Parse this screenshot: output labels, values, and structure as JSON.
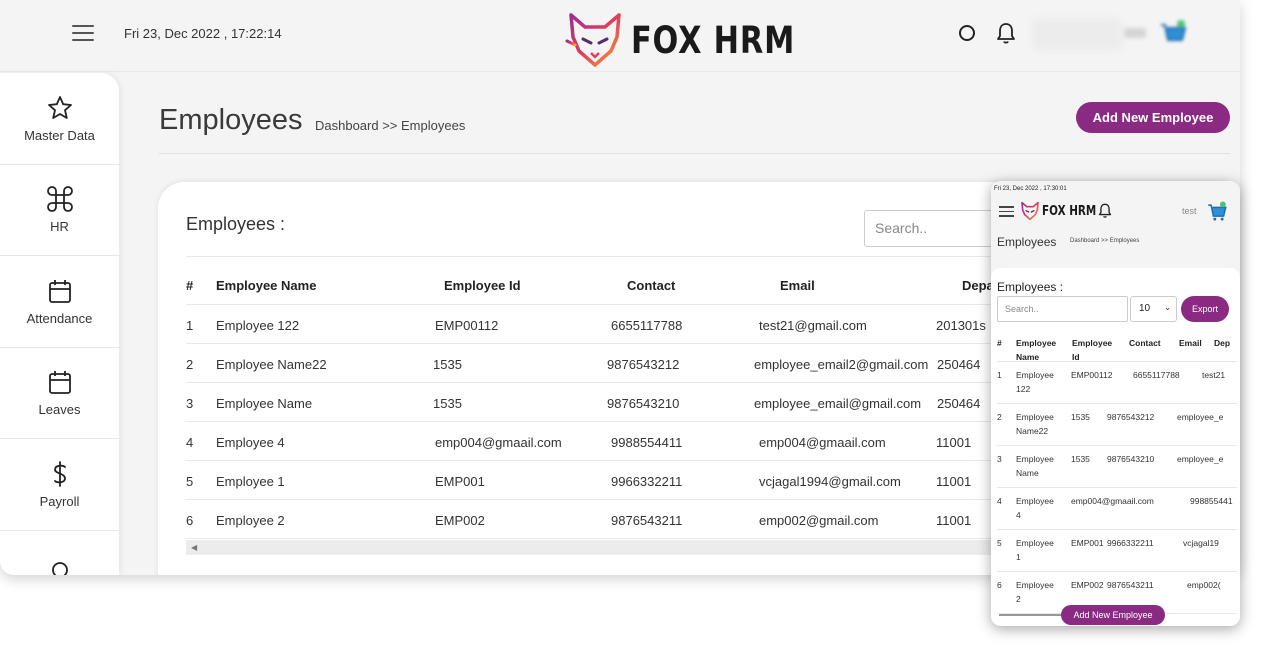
{
  "header": {
    "datetime": "Fri 23, Dec 2022 , 17:22:14",
    "brand": "FOX HRM"
  },
  "sidebar": {
    "items": [
      {
        "label": "Master Data",
        "icon": "star-icon"
      },
      {
        "label": "HR",
        "icon": "command-icon"
      },
      {
        "label": "Attendance",
        "icon": "calendar-icon"
      },
      {
        "label": "Leaves",
        "icon": "calendar-icon"
      },
      {
        "label": "Payroll",
        "icon": "dollar-icon"
      },
      {
        "label": "",
        "icon": "award-icon"
      }
    ]
  },
  "page": {
    "title": "Employees",
    "breadcrumb": "Dashboard >> Employees",
    "add_button": "Add New Employee"
  },
  "card": {
    "title": "Employees :",
    "search_placeholder": "Search.."
  },
  "table": {
    "columns": [
      "#",
      "Employee Name",
      "Employee Id",
      "Contact",
      "Email",
      "Depa"
    ],
    "rows": [
      [
        "1",
        "Employee 122",
        "EMP00112",
        "6655117788",
        "test21@gmail.com",
        "201301s"
      ],
      [
        "2",
        "Employee Name22",
        "1535",
        "9876543212",
        "employee_email2@gmail.com",
        "250464"
      ],
      [
        "3",
        "Employee Name",
        "1535",
        "9876543210",
        "employee_email@gmail.com",
        "250464"
      ],
      [
        "4",
        "Employee 4",
        "emp004@gmaail.com",
        "9988554411",
        "emp004@gmaail.com",
        "11001"
      ],
      [
        "5",
        "Employee 1",
        "EMP001",
        "9966332211",
        "vcjagal1994@gmail.com",
        "11001"
      ],
      [
        "6",
        "Employee 2",
        "EMP002",
        "9876543211",
        "emp002@gmail.com",
        "11001"
      ]
    ]
  },
  "mobile": {
    "datetime": "Fri 23, Dec 2022 , 17:30:01",
    "brand": "FOX HRM",
    "user": "test",
    "title": "Employees",
    "breadcrumb": "Dashboard >> Employees",
    "card_title": "Employees :",
    "search_placeholder": "Search..",
    "page_size": "10",
    "export": "Export",
    "add_button": "Add New Employee",
    "columns": [
      [
        "#",
        ""
      ],
      [
        "Employee",
        "Name"
      ],
      [
        "Employee",
        "Id"
      ],
      [
        "Contact",
        ""
      ],
      [
        "Email",
        ""
      ],
      [
        "Dep",
        ""
      ]
    ],
    "rows": [
      [
        "1",
        "Employee",
        "122",
        "EMP00112",
        "6655117788",
        "test21"
      ],
      [
        "2",
        "Employee",
        "Name22",
        "1535",
        "9876543212",
        "employee_e"
      ],
      [
        "3",
        "Employee",
        "Name",
        "1535",
        "9876543210",
        "employee_e"
      ],
      [
        "4",
        "Employee",
        "4",
        "emp004@gmaail.com",
        "998855441",
        ""
      ],
      [
        "5",
        "Employee",
        "1",
        "EMP001",
        "9966332211",
        "vcjagal19"
      ],
      [
        "6",
        "Employee",
        "2",
        "EMP002",
        "9876543211",
        "emp002("
      ]
    ]
  },
  "colors": {
    "accent": "#8a2a83",
    "background": "#f4f4f4"
  }
}
